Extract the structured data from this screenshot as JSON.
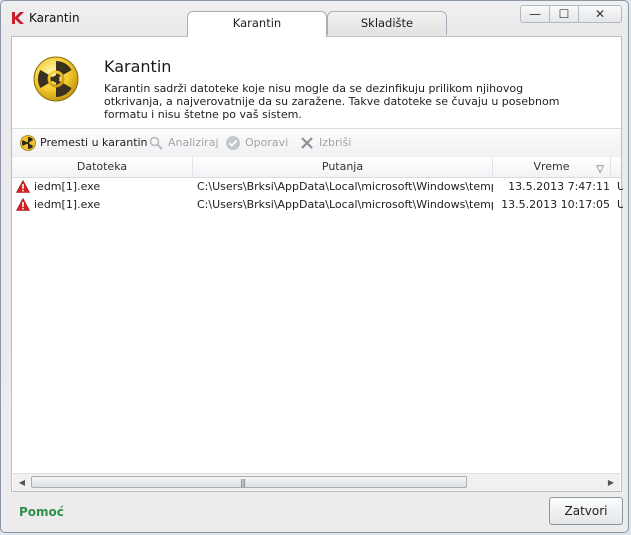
{
  "window": {
    "title": "Karantin",
    "tabs": [
      {
        "label": "Karantin",
        "active": true
      },
      {
        "label": "Skladište",
        "active": false
      }
    ],
    "controls": {
      "minimize": "—",
      "maximize": "☐",
      "close": "✕"
    }
  },
  "header": {
    "title": "Karantin",
    "description": "Karantin sadrži datoteke koje nisu mogle da se dezinfikuju prilikom njihovog otkrivanja, a najverovatnije da su zaražene. Takve datoteke se čuvaju u posebnom formatu i nisu štetne po vaš sistem.",
    "icon": "radiation-hazard-icon"
  },
  "toolbar": {
    "items": [
      {
        "label": "Premesti u karantin",
        "icon": "radiation-icon",
        "enabled": true
      },
      {
        "label": "Analiziraj",
        "icon": "magnifier-icon",
        "enabled": false
      },
      {
        "label": "Oporavi",
        "icon": "restore-icon",
        "enabled": false
      },
      {
        "label": "Izbriši",
        "icon": "delete-icon",
        "enabled": false
      }
    ]
  },
  "table": {
    "columns": [
      "Datoteka",
      "Putanja",
      "Vreme"
    ],
    "sort_indicator": "▽",
    "rows": [
      {
        "file": "iedm[1].exe",
        "path": "C:\\Users\\Brksi\\AppData\\Local\\microsoft\\Windows\\temp…",
        "time": "13.5.2013 7:47:11",
        "extra": "U"
      },
      {
        "file": "iedm[1].exe",
        "path": "C:\\Users\\Brksi\\AppData\\Local\\microsoft\\Windows\\temp…",
        "time": "13.5.2013 10:17:05",
        "extra": "U"
      }
    ]
  },
  "scrollbar": {
    "left": "◀",
    "right": "▶",
    "grip": "|||"
  },
  "footer": {
    "help_label": "Pomoć",
    "close_label": "Zatvori"
  },
  "colors": {
    "accent_green": "#2f8f4a",
    "warning_red": "#d32020",
    "hazard_yellow": "#f5cc2e"
  }
}
